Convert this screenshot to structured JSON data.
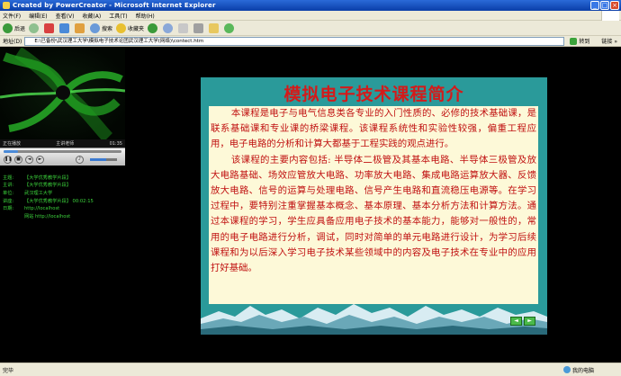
{
  "window": {
    "title": "Created by PowerCreator - Microsoft Internet Explorer"
  },
  "menu": [
    "文件(F)",
    "编辑(E)",
    "查看(V)",
    "收藏(A)",
    "工具(T)",
    "帮助(H)"
  ],
  "toolbar": {
    "back": "后退",
    "search": "搜索",
    "favorites": "收藏夹"
  },
  "address": {
    "label": "地址(D)",
    "value": "E:\\已备份\\武汉理工大学\\模拟电子技术论团武汉理工大学(网络)\\contect.htm",
    "go": "转到",
    "links": "链接 »"
  },
  "player": {
    "status_left": "正在播放",
    "status_mid": "主讲老师",
    "time": "01:35",
    "seek_progress": 0.12,
    "volume": 0.6
  },
  "info": [
    {
      "k": "主题:",
      "v": "【大学优秀教学片段】"
    },
    {
      "k": "主讲:",
      "v": "【大学优秀教学片段】"
    },
    {
      "k": "单位:",
      "v": "武汉理工大学"
    },
    {
      "k": "讲座:",
      "v": "【大学优秀教学片段】 00:02:15"
    },
    {
      "k": "日期:",
      "v": "http://localhost"
    },
    {
      "k": "",
      "v": "网站 http://localhost"
    }
  ],
  "slide": {
    "title": "模拟电子技术课程简介",
    "p1": "本课程是电子与电气信息类各专业的入门性质的、必修的技术基础课，是联系基础课和专业课的桥梁课程。该课程系统性和实验性较强，偏重工程应用，电子电路的分析和计算大都基于工程实践的观点进行。",
    "p2": "该课程的主要内容包括: 半导体二极管及其基本电路、半导体三极管及放大电路基础、场效应管放大电路、功率放大电路、集成电路运算放大器、反馈放大电路、信号的运算与处理电路、信号产生电路和直流稳压电源等。在学习过程中，要特别注重掌握基本概念、基本原理、基本分析方法和计算方法。通过本课程的学习，学生应具备应用电子技术的基本能力，能够对一般性的，常用的电子电路进行分析，调试，同时对简单的单元电路进行设计，为学习后续课程和为以后深入学习电子技术某些领域中的内容及电子技术在专业中的应用打好基础。",
    "nav_prev": "◄",
    "nav_next": "►"
  },
  "status": {
    "left": "完毕",
    "zone": "我的电脑"
  },
  "colors": {
    "slide_bg": "#2a9a9a",
    "slide_text": "#c01010",
    "title": "#d41a1a",
    "info": "#3cd43c"
  }
}
